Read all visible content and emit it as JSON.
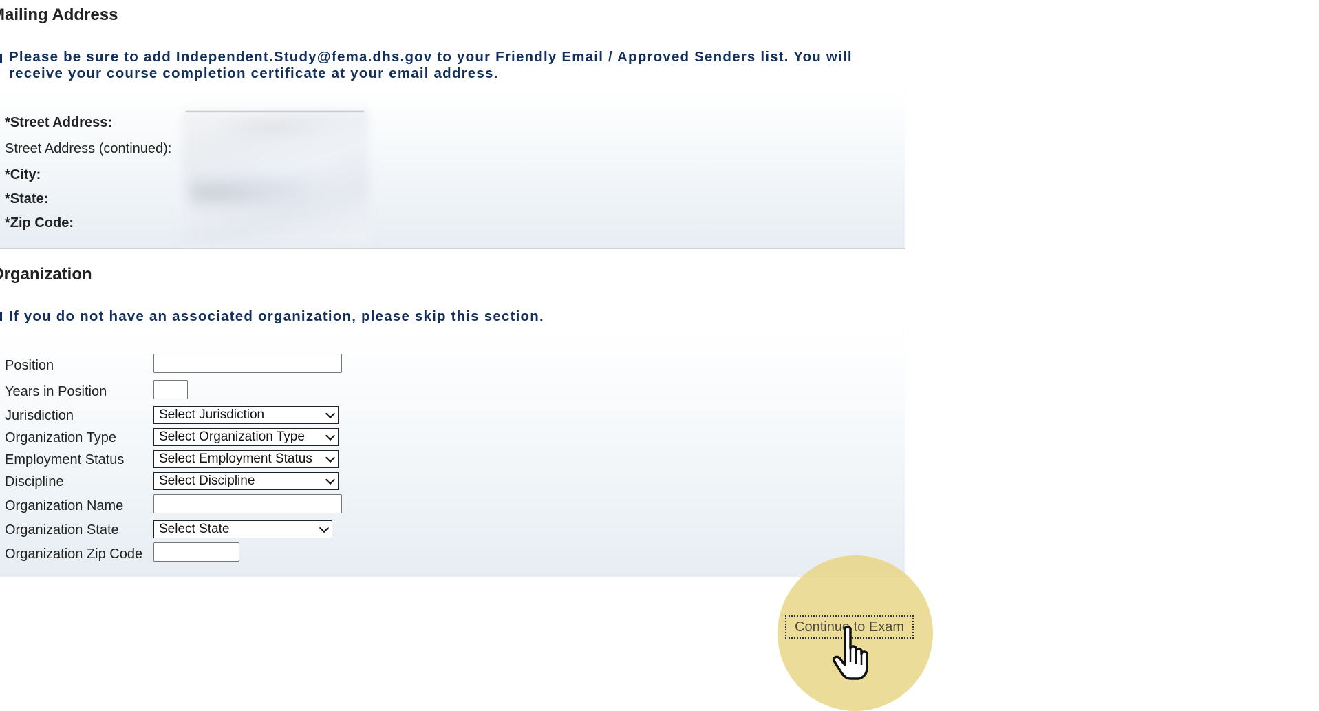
{
  "mailing": {
    "title": "Mailing Address",
    "notice": "Please be sure to add Independent.Study@fema.dhs.gov to your Friendly Email / Approved Senders list. You will receive your course completion certificate at your email address.",
    "fields": {
      "street": "*Street Address:",
      "street2": "Street Address (continued):",
      "city": "*City:",
      "state": "*State:",
      "zip": "*Zip Code:"
    }
  },
  "organization": {
    "title": "Organization",
    "notice": "If you do not have an associated organization, please skip this section.",
    "labels": {
      "position": "Position",
      "years": "Years in Position",
      "jurisdiction": "Jurisdiction",
      "org_type": "Organization Type",
      "employment": "Employment Status",
      "discipline": "Discipline",
      "org_name": "Organization Name",
      "org_state": "Organization State",
      "org_zip": "Organization Zip Code"
    },
    "selects": {
      "jurisdiction": "Select Jurisdiction",
      "org_type": "Select Organization Type",
      "employment": "Select Employment Status",
      "discipline": "Select Discipline",
      "org_state": "Select State"
    }
  },
  "actions": {
    "continue_label": "Continue to Exam"
  },
  "colors": {
    "notice_text": "#14305a",
    "highlight": "#e8d482"
  }
}
